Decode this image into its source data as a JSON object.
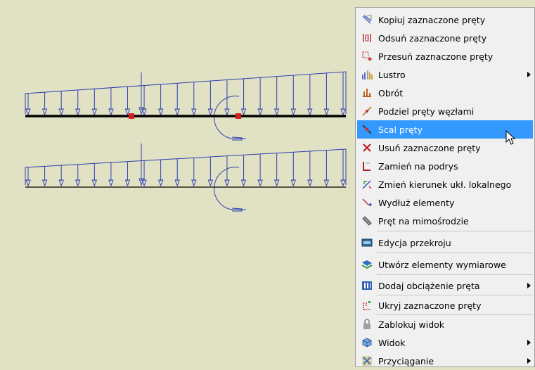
{
  "canvas": {
    "background": "#E1E1C3",
    "load_color": "#2E3FB5",
    "beam_color": "#000000",
    "node_color": "#D32020"
  },
  "menu": {
    "items": [
      {
        "label": "Kopiuj zaznaczone pręty",
        "icon": "copy-bars-icon"
      },
      {
        "label": "Odsuń zaznaczone pręty",
        "icon": "offset-bars-icon"
      },
      {
        "label": "Przesuń zaznaczone pręty",
        "icon": "move-bars-icon"
      },
      {
        "label": "Lustro",
        "icon": "mirror-icon",
        "submenu": true
      },
      {
        "label": "Obrót",
        "icon": "rotate-icon"
      },
      {
        "label": "Podziel pręty węzłami",
        "icon": "divide-bars-icon"
      },
      {
        "label": "Scal pręty",
        "icon": "merge-bars-icon",
        "highlighted": true
      },
      {
        "label": "Usuń zaznaczone pręty",
        "icon": "delete-bars-icon"
      },
      {
        "label": "Zamień na podrys",
        "icon": "convert-to-underlay-icon"
      },
      {
        "label": "Zmień kierunek ukł. lokalnego",
        "icon": "change-local-axis-icon"
      },
      {
        "label": "Wydłuż elementy",
        "icon": "extend-elements-icon"
      },
      {
        "label": "Pręt na mimośrodzie",
        "icon": "eccentric-bar-icon"
      },
      {
        "label": "Edycja przekroju",
        "icon": "edit-section-icon"
      },
      {
        "label": "Utwórz elementy wymiarowe",
        "icon": "create-dimension-elements-icon"
      },
      {
        "label": "Dodaj obciążenie pręta",
        "icon": "add-bar-load-icon",
        "submenu": true
      },
      {
        "label": "Ukryj zaznaczone pręty",
        "icon": "hide-bars-icon"
      },
      {
        "label": "Zablokuj widok",
        "icon": "lock-view-icon"
      },
      {
        "label": "Widok",
        "icon": "view-icon",
        "submenu": true
      },
      {
        "label": "Przyciąganie",
        "icon": "snap-icon",
        "submenu": true
      }
    ],
    "highlight_color": "#3399FF"
  }
}
